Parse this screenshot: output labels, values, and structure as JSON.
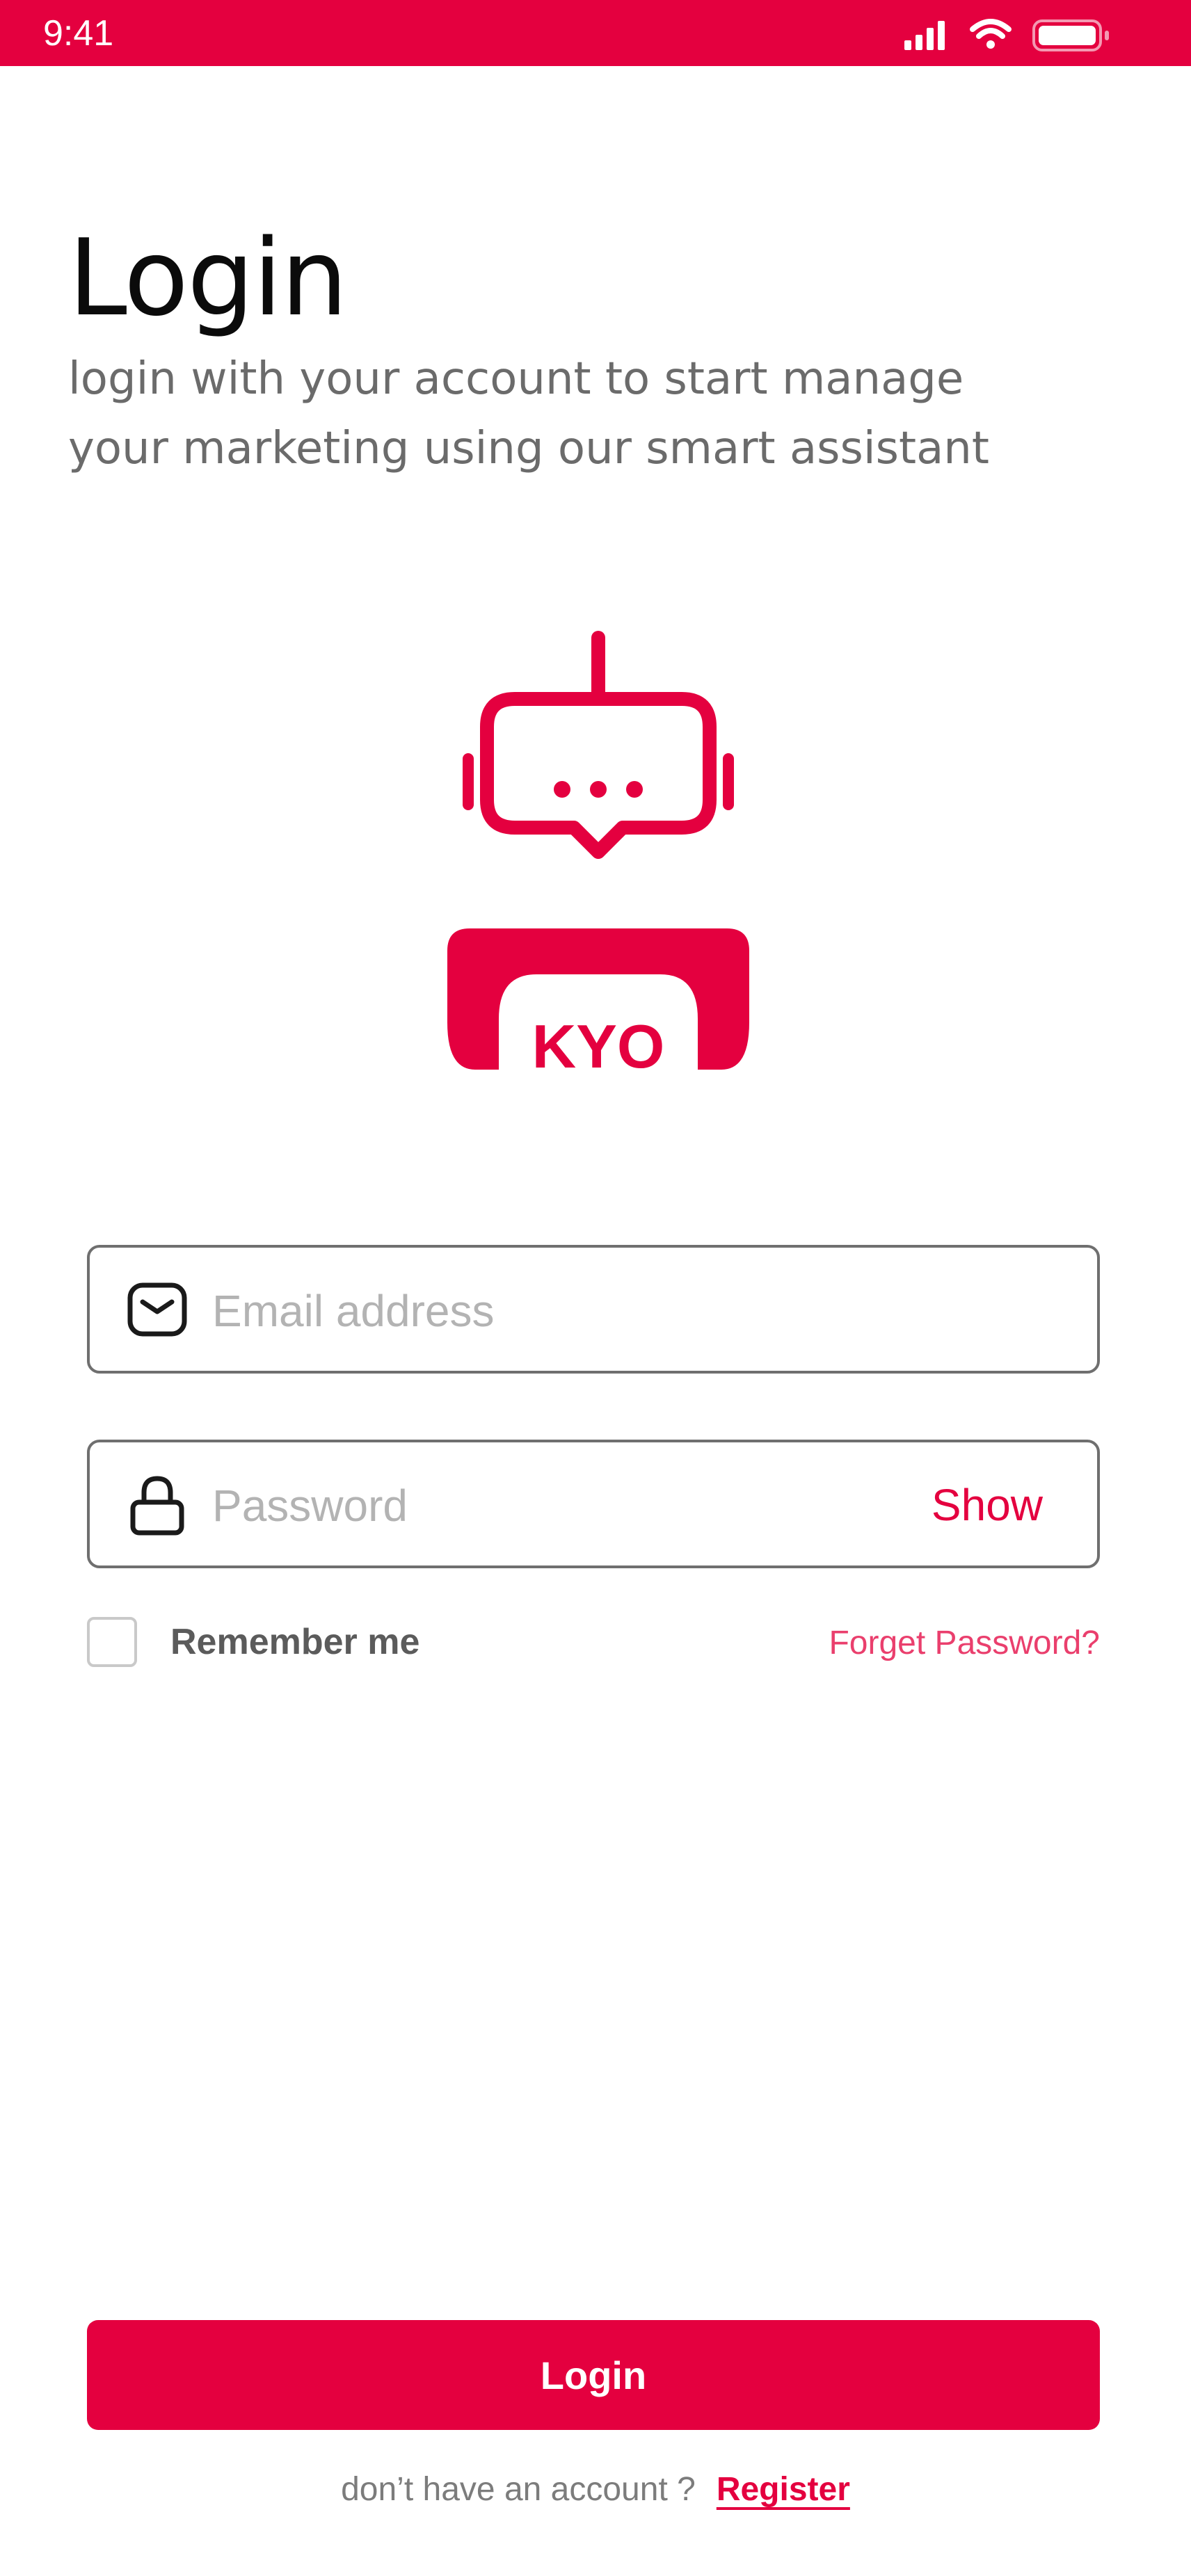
{
  "status_bar": {
    "time": "9:41",
    "icons": [
      "signal-icon",
      "wifi-icon",
      "battery-icon"
    ],
    "background_color": "#e4003f"
  },
  "header": {
    "title": "Login",
    "subtitle_line1": "login with your account to start manage",
    "subtitle_line2": "your marketing using our smart assistant"
  },
  "logo": {
    "icon": "robot-chat-icon",
    "brand_text": "KYO",
    "color": "#e4003f"
  },
  "form": {
    "email": {
      "icon": "envelope-icon",
      "placeholder": "Email address",
      "value": ""
    },
    "password": {
      "icon": "lock-icon",
      "placeholder": "Password",
      "value": "",
      "toggle_label": "Show"
    },
    "remember_me": {
      "label": "Remember me",
      "checked": false
    },
    "forgot_password_label": "Forget Password?"
  },
  "actions": {
    "login_label": "Login",
    "register_prompt": "don’t have an account ?",
    "register_label": "Register"
  },
  "colors": {
    "accent": "#e4003f",
    "accent_light": "#ea3f6d",
    "field_border": "#6f6f6f",
    "placeholder": "#b3b3b3",
    "muted_text": "#6b6b6b"
  }
}
